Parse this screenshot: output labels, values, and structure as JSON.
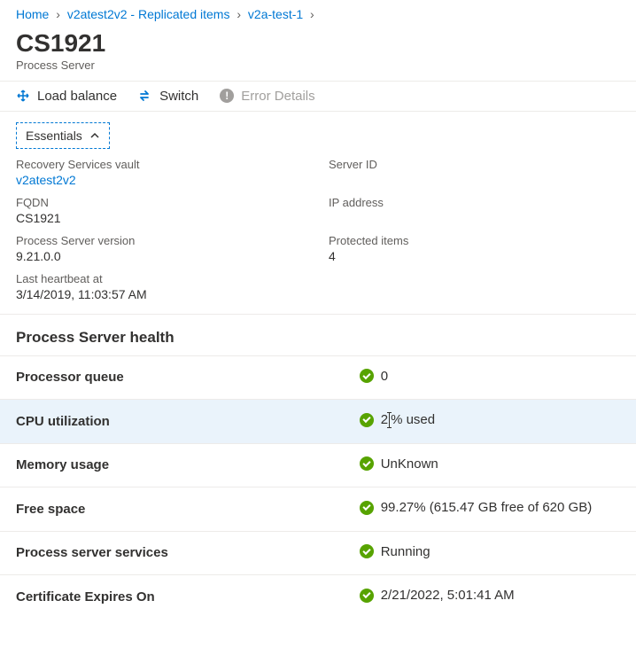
{
  "breadcrumb": {
    "items": [
      {
        "label": "Home"
      },
      {
        "label": "v2atest2v2 - Replicated items"
      },
      {
        "label": "v2a-test-1"
      }
    ]
  },
  "header": {
    "title": "CS1921",
    "subtitle": "Process Server"
  },
  "commands": {
    "load_balance": "Load balance",
    "switch": "Switch",
    "error_details": "Error Details"
  },
  "essentials": {
    "toggle_label": "Essentials",
    "left": [
      {
        "label": "Recovery Services vault",
        "value": "v2atest2v2",
        "link": true
      },
      {
        "label": "FQDN",
        "value": "CS1921"
      },
      {
        "label": "Process Server version",
        "value": "9.21.0.0"
      },
      {
        "label": "Last heartbeat at",
        "value": "3/14/2019, 11:03:57 AM"
      }
    ],
    "right": [
      {
        "label": "Server ID",
        "value": ""
      },
      {
        "label": "IP address",
        "value": ""
      },
      {
        "label": "Protected items",
        "value": "4"
      }
    ]
  },
  "health": {
    "heading": "Process Server health",
    "rows": [
      {
        "key": "Processor queue",
        "value": "0"
      },
      {
        "key": "CPU utilization",
        "value_prefix": "2",
        "value_suffix": "% used",
        "selected": true,
        "has_cursor": true
      },
      {
        "key": "Memory usage",
        "value": "UnKnown"
      },
      {
        "key": "Free space",
        "value": "99.27% (615.47 GB free of 620 GB)"
      },
      {
        "key": "Process server services",
        "value": "Running"
      },
      {
        "key": "Certificate Expires On",
        "value": "2/21/2022, 5:01:41 AM"
      }
    ]
  }
}
